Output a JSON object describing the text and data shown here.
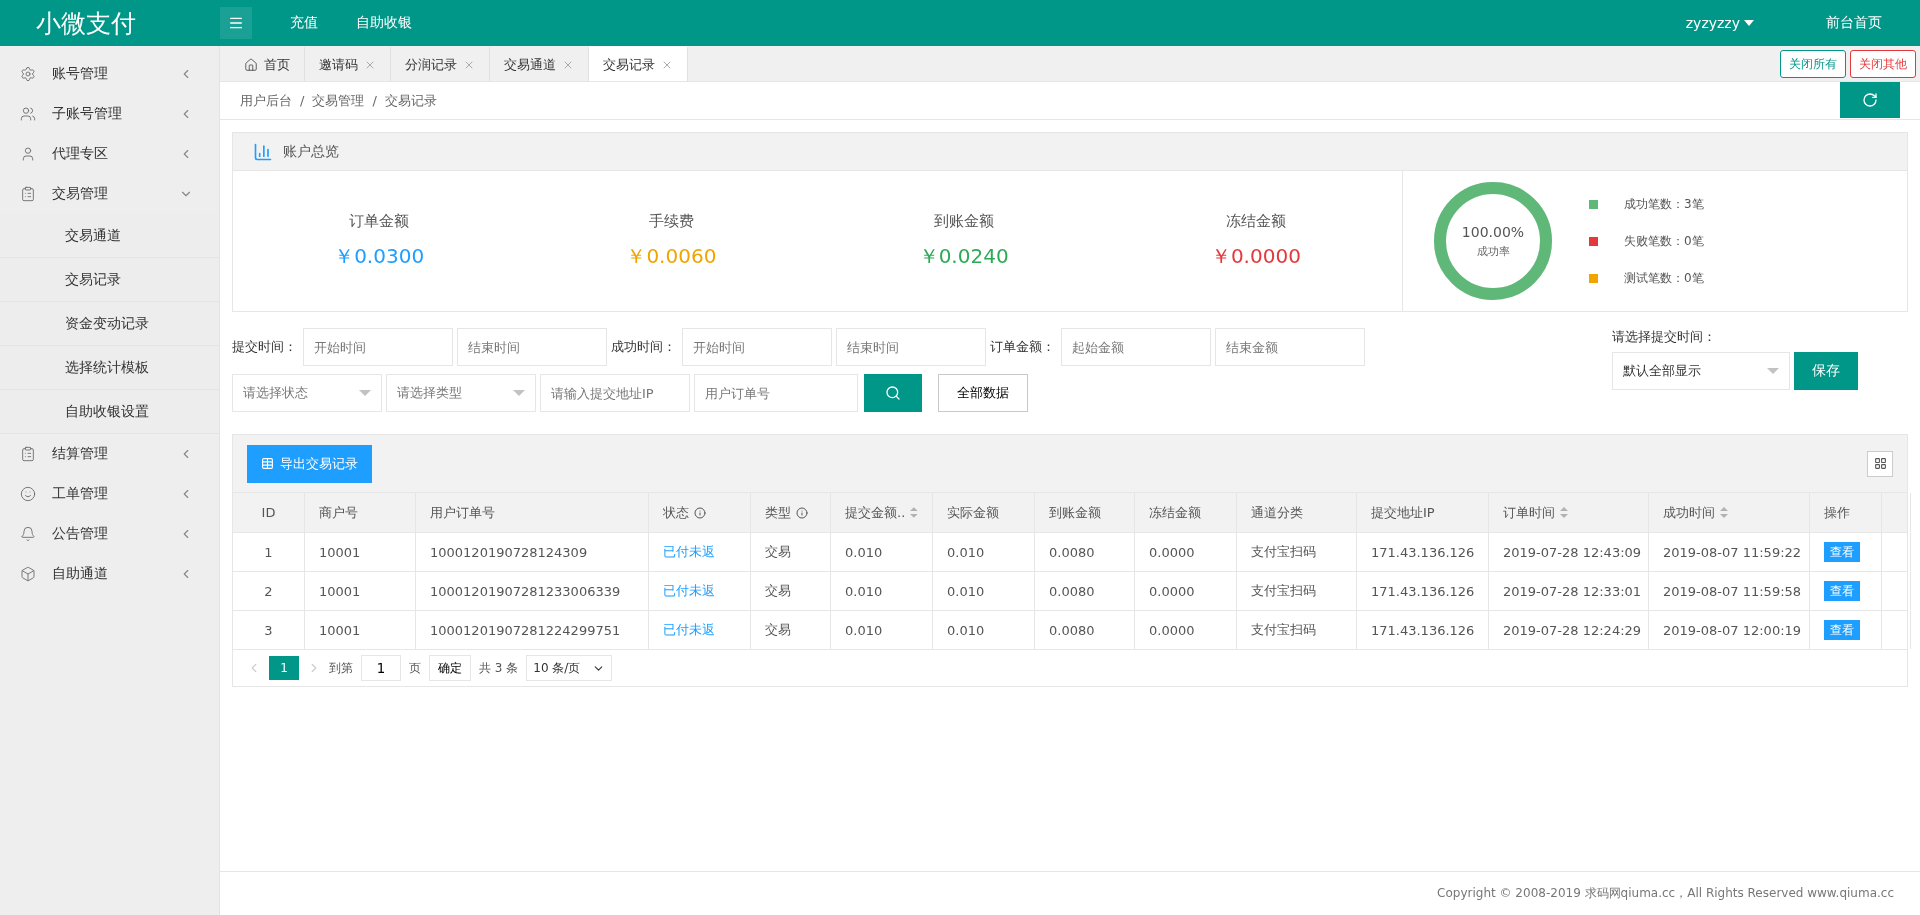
{
  "header": {
    "logo": "小微支付",
    "nav": [
      "充值",
      "自助收银"
    ],
    "user": "zyzyzzy",
    "home_link": "前台首页"
  },
  "sidebar": {
    "items": [
      {
        "label": "账号管理",
        "expanded": false
      },
      {
        "label": "子账号管理",
        "expanded": false
      },
      {
        "label": "代理专区",
        "expanded": false
      },
      {
        "label": "交易管理",
        "expanded": true,
        "children": [
          {
            "label": "交易通道",
            "selected": false
          },
          {
            "label": "交易记录",
            "selected": false
          },
          {
            "label": "资金变动记录",
            "selected": false
          },
          {
            "label": "选择统计模板",
            "selected": false
          },
          {
            "label": "自助收银设置",
            "selected": false
          }
        ]
      },
      {
        "label": "结算管理",
        "expanded": false
      },
      {
        "label": "工单管理",
        "expanded": false
      },
      {
        "label": "公告管理",
        "expanded": false
      },
      {
        "label": "自助通道",
        "expanded": false
      }
    ]
  },
  "tabs": [
    {
      "label": "首页",
      "kind": "home",
      "selected": false
    },
    {
      "label": "邀请码",
      "kind": "page",
      "selected": false
    },
    {
      "label": "分润记录",
      "kind": "page",
      "selected": false
    },
    {
      "label": "交易通道",
      "kind": "page",
      "selected": false
    },
    {
      "label": "交易记录",
      "kind": "page",
      "selected": true
    }
  ],
  "tab_actions": [
    {
      "label": "关闭所有",
      "color": "#009688"
    },
    {
      "label": "关闭其他",
      "color": "#e4393c"
    }
  ],
  "breadcrumb": {
    "separator": "/",
    "items": [
      "用户后台",
      "交易管理",
      "交易记录"
    ]
  },
  "summary": {
    "title": "账户总览",
    "stats": [
      {
        "label": "订单金额",
        "value": "￥0.0300",
        "color": "#1e9fff"
      },
      {
        "label": "手续费",
        "value": "￥0.0060",
        "color": "#f0a500"
      },
      {
        "label": "到账金额",
        "value": "￥0.0240",
        "color": "#2eaa57"
      },
      {
        "label": "冻结金额",
        "value": "￥0.0000",
        "color": "#e4393c"
      }
    ],
    "donut": {
      "percent": "100.00%",
      "caption": "成功率",
      "level": 1
    },
    "legend": [
      {
        "label": "成功笔数：3笔",
        "color": "#5fb878"
      },
      {
        "label": "失败笔数：0笔",
        "color": "#e4393c"
      },
      {
        "label": "测试笔数：0笔",
        "color": "#f0a500"
      }
    ]
  },
  "filters": {
    "ranges": [
      {
        "label": "提交时间：",
        "fields": [
          {
            "placeholder": "开始时间"
          },
          {
            "placeholder": "结束时间"
          }
        ]
      },
      {
        "label": "成功时间：",
        "fields": [
          {
            "placeholder": "开始时间"
          },
          {
            "placeholder": "结束时间"
          }
        ]
      },
      {
        "label": "订单金额：",
        "fields": [
          {
            "placeholder": "起始金额"
          },
          {
            "placeholder": "结束金额"
          }
        ]
      }
    ],
    "selects": [
      {
        "placeholder": "请选择状态"
      },
      {
        "placeholder": "请选择类型"
      }
    ],
    "inputs": [
      {
        "placeholder": "请输入提交地址IP"
      },
      {
        "placeholder": "用户订单号"
      }
    ],
    "all_button": "全部数据",
    "time_label": "请选择提交时间：",
    "time_select": "默认全部显示",
    "save_button": "保存"
  },
  "table": {
    "export_button": "导出交易记录",
    "columns": [
      {
        "label": "ID",
        "info": false,
        "sortable": false
      },
      {
        "label": "商户号",
        "info": false,
        "sortable": false
      },
      {
        "label": "用户订单号",
        "info": false,
        "sortable": false
      },
      {
        "label": "状态",
        "info": true,
        "sortable": false
      },
      {
        "label": "类型",
        "info": true,
        "sortable": false
      },
      {
        "label": "提交金额..",
        "info": false,
        "sortable": true
      },
      {
        "label": "实际金额",
        "info": false,
        "sortable": false
      },
      {
        "label": "到账金额",
        "info": false,
        "sortable": false
      },
      {
        "label": "冻结金额",
        "info": false,
        "sortable": false
      },
      {
        "label": "通道分类",
        "info": false,
        "sortable": false
      },
      {
        "label": "提交地址IP",
        "info": false,
        "sortable": false
      },
      {
        "label": "订单时间",
        "info": false,
        "sortable": true
      },
      {
        "label": "成功时间",
        "info": false,
        "sortable": true
      },
      {
        "label": "操作",
        "info": false,
        "sortable": false
      }
    ],
    "rows": [
      {
        "cells": [
          "1",
          "10001",
          "1000120190728124309",
          "已付未返",
          "交易",
          "0.010",
          "0.010",
          "0.0080",
          "0.0000",
          "支付宝扫码",
          "171.43.136.126",
          "2019-07-28 12:43:09",
          "2019-08-07 11:59:22"
        ],
        "action": "查看"
      },
      {
        "cells": [
          "2",
          "10001",
          "10001201907281233006339",
          "已付未返",
          "交易",
          "0.010",
          "0.010",
          "0.0080",
          "0.0000",
          "支付宝扫码",
          "171.43.136.126",
          "2019-07-28 12:33:01",
          "2019-08-07 11:59:58"
        ],
        "action": "查看"
      },
      {
        "cells": [
          "3",
          "10001",
          "10001201907281224299751",
          "已付未返",
          "交易",
          "0.010",
          "0.010",
          "0.0080",
          "0.0000",
          "支付宝扫码",
          "171.43.136.126",
          "2019-07-28 12:24:29",
          "2019-08-07 12:00:19"
        ],
        "action": "查看"
      }
    ],
    "pager": {
      "current": "1",
      "goto_label": "到第",
      "goto_value": "1",
      "page_unit": "页",
      "confirm": "确定",
      "total": "共 3 条",
      "page_size": "10 条/页"
    }
  },
  "footer": "Copyright © 2008-2019 求码网qiuma.cc，All Rights Reserved www.qiuma.cc"
}
